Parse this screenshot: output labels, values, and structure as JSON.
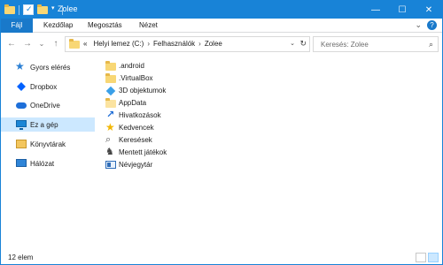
{
  "window": {
    "title": "Zolee",
    "buttons": {
      "minimize": "—",
      "maximize": "☐",
      "close": "✕"
    }
  },
  "ribbon": {
    "tabs": [
      "Fájl",
      "Kezdőlap",
      "Megosztás",
      "Nézet"
    ],
    "expand_glyph": "⌄",
    "help_glyph": "?"
  },
  "nav": {
    "back": "←",
    "forward": "→",
    "recent": "⌄",
    "up": "↑"
  },
  "address": {
    "overflow": "«",
    "crumbs": [
      "Helyi lemez (C:)",
      "Felhasználók",
      "Zolee"
    ],
    "separator": "›",
    "dropdown": "⌄",
    "refresh": "↻"
  },
  "search": {
    "placeholder": "Keresés: Zolee",
    "icon": "⌕"
  },
  "sidebar": {
    "items": [
      {
        "label": "Gyors elérés",
        "icon": "star-icon"
      },
      {
        "label": "Dropbox",
        "icon": "dropbox-icon"
      },
      {
        "label": "OneDrive",
        "icon": "onedrive-icon"
      },
      {
        "label": "Ez a gép",
        "icon": "computer-icon",
        "selected": true
      },
      {
        "label": "Könyvtárak",
        "icon": "library-icon"
      },
      {
        "label": "Hálózat",
        "icon": "network-icon"
      }
    ]
  },
  "files": [
    {
      "name": ".android",
      "icon": "folder-icon"
    },
    {
      "name": ".VirtualBox",
      "icon": "folder-icon"
    },
    {
      "name": "3D objektumok",
      "icon": "3d-objects-icon"
    },
    {
      "name": "AppData",
      "icon": "folder-icon"
    },
    {
      "name": "Hivatkozások",
      "icon": "links-icon"
    },
    {
      "name": "Kedvencek",
      "icon": "favorites-icon"
    },
    {
      "name": "Keresések",
      "icon": "searches-icon"
    },
    {
      "name": "Mentett játékok",
      "icon": "saved-games-icon"
    },
    {
      "name": "Névjegytár",
      "icon": "contacts-icon"
    }
  ],
  "status": {
    "item_count": "12 elem"
  },
  "colors": {
    "titlebar": "#1883d7",
    "file_tab": "#1979ca",
    "selection": "#cce8ff",
    "folder": "#f8d775"
  }
}
